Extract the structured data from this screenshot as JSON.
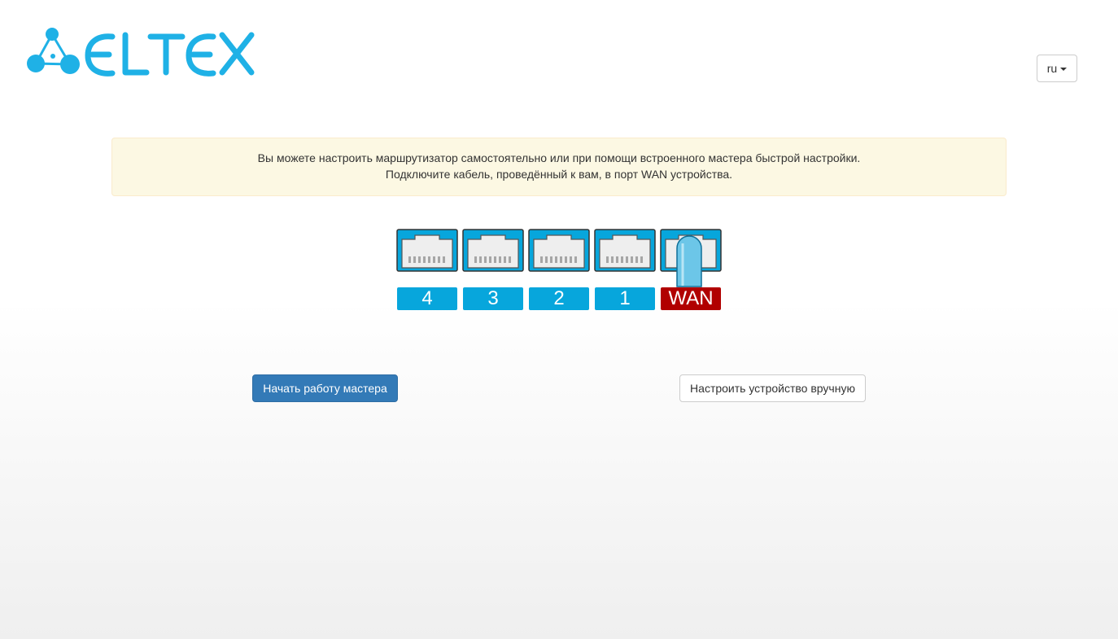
{
  "brand": {
    "logo_text": "ELTEX",
    "color": "#1fb1e6"
  },
  "header": {
    "language": "ru"
  },
  "alert": {
    "line1": "Вы можете настроить маршрутизатор самостоятельно или при помощи встроенного мастера быстрой настройки.",
    "line2": "Подключите кабель, проведённый к вам, в порт WAN устройства."
  },
  "ports": [
    {
      "label": "4",
      "type": "lan",
      "connected": false
    },
    {
      "label": "3",
      "type": "lan",
      "connected": false
    },
    {
      "label": "2",
      "type": "lan",
      "connected": false
    },
    {
      "label": "1",
      "type": "lan",
      "connected": false
    },
    {
      "label": "WAN",
      "type": "wan",
      "connected": true
    }
  ],
  "colors": {
    "port_blue": "#07a6dc",
    "wan_red": "#b10000",
    "alert_bg": "#fcf8e3",
    "primary": "#337ab7"
  },
  "actions": {
    "start_wizard": "Начать работу мастера",
    "manual_setup": "Настроить устройство вручную"
  }
}
